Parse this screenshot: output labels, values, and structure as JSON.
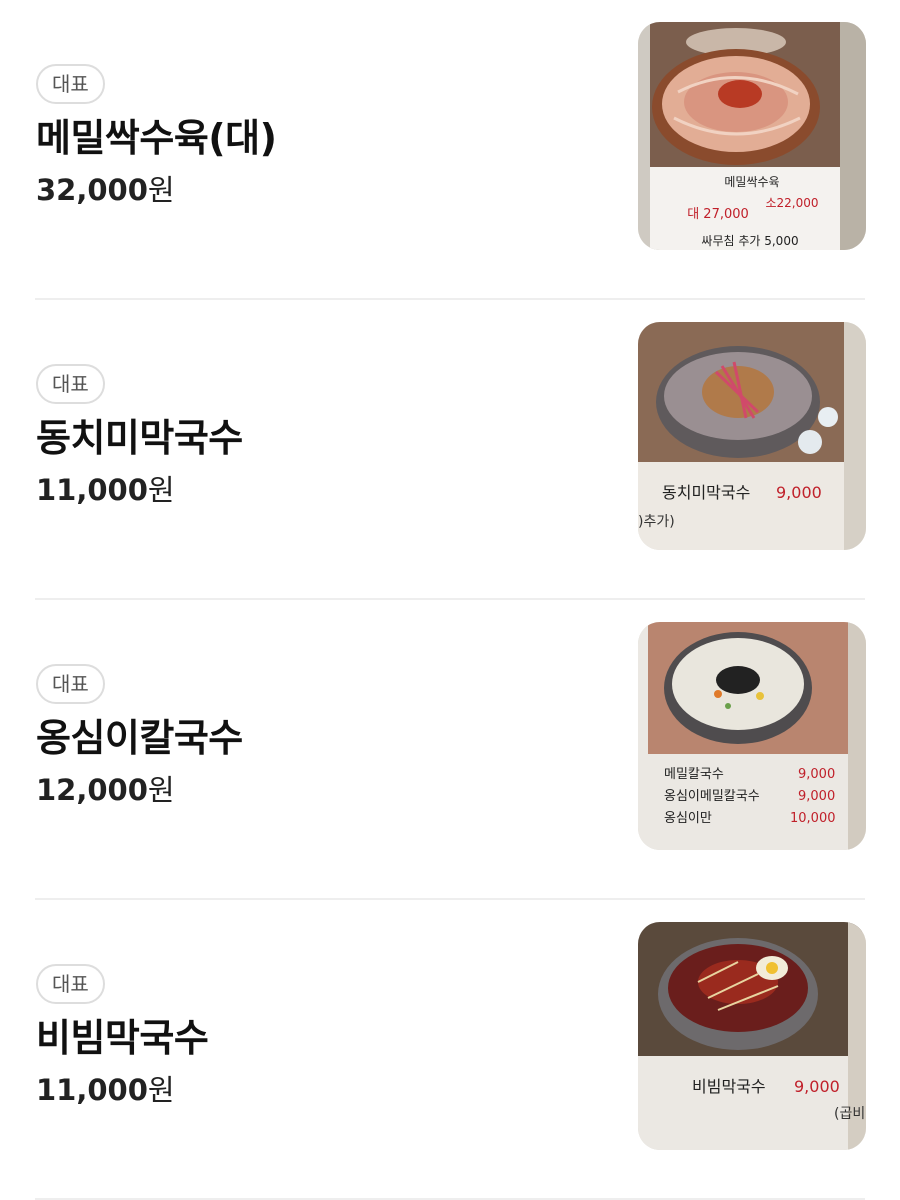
{
  "menu": {
    "items": [
      {
        "badge": "대표",
        "name": "메밀싹수육(대)",
        "price": "32,000",
        "currency": "원",
        "photo": {
          "icon": "boiled-pork-dish-photo",
          "caption_title": "메밀싹수육",
          "caption_price_large": "대 27,000",
          "caption_price_small": "소22,000",
          "caption_extra": "싸무침 추가 5,000"
        }
      },
      {
        "badge": "대표",
        "name": "동치미막국수",
        "price": "11,000",
        "currency": "원",
        "photo": {
          "icon": "cold-noodle-bowl-photo",
          "caption_title": "동치미막국수",
          "caption_price": "9,000",
          "caption_extra": ")추가)"
        }
      },
      {
        "badge": "대표",
        "name": "옹심이칼국수",
        "price": "12,000",
        "currency": "원",
        "photo": {
          "icon": "knife-noodle-bowl-photo",
          "rows": [
            {
              "label": "메밀칼국수",
              "price": "9,000"
            },
            {
              "label": "옹심이메밀칼국수",
              "price": "9,000"
            },
            {
              "label": "옹심이만",
              "price": "10,000"
            }
          ]
        }
      },
      {
        "badge": "대표",
        "name": "비빔막국수",
        "price": "11,000",
        "currency": "원",
        "photo": {
          "icon": "spicy-noodle-bowl-photo",
          "caption_title": "비빔막국수",
          "caption_price": "9,000",
          "caption_extra": "(곱비"
        }
      }
    ]
  },
  "colors": {
    "badge_border": "#dddddd",
    "divider": "#eeeeee",
    "menu_price_red": "#c0202a"
  }
}
